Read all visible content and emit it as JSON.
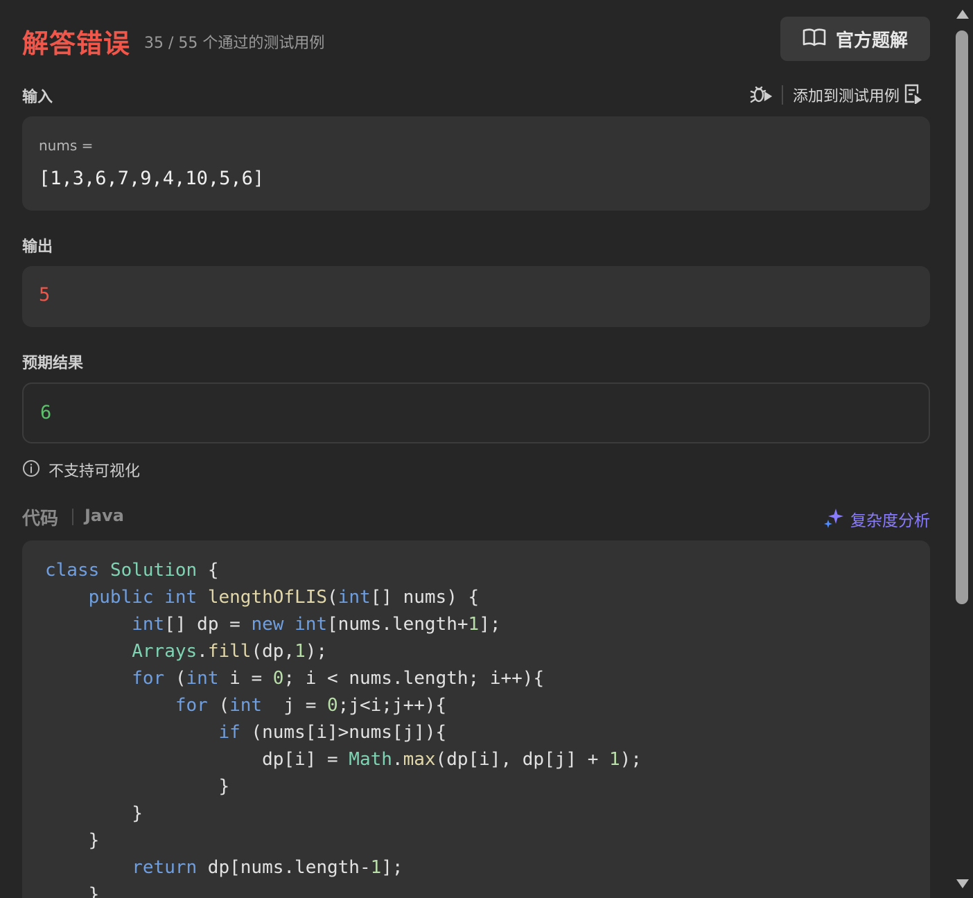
{
  "result": {
    "status": "解答错误",
    "passed": "35 / 55",
    "passed_suffix": "个通过的测试用例"
  },
  "header": {
    "solution_button": "官方题解"
  },
  "input": {
    "label": "输入",
    "add_to_tests": "添加到测试用例",
    "var_name": "nums =",
    "var_value": "[1,3,6,7,9,4,10,5,6]"
  },
  "output": {
    "label": "输出",
    "value": "5"
  },
  "expected": {
    "label": "预期结果",
    "value": "6"
  },
  "visualization_note": "不支持可视化",
  "code": {
    "label": "代码",
    "language": "Java",
    "complexity_button": "复杂度分析"
  },
  "icons": {
    "solution": "book-icon",
    "debug": "bug-icon",
    "add_test": "add-document-icon",
    "info": "info-icon",
    "ai": "sparkle-icon"
  },
  "colors": {
    "error": "#f0564a",
    "success": "#5cc16a",
    "accent": "#8a7cff"
  }
}
